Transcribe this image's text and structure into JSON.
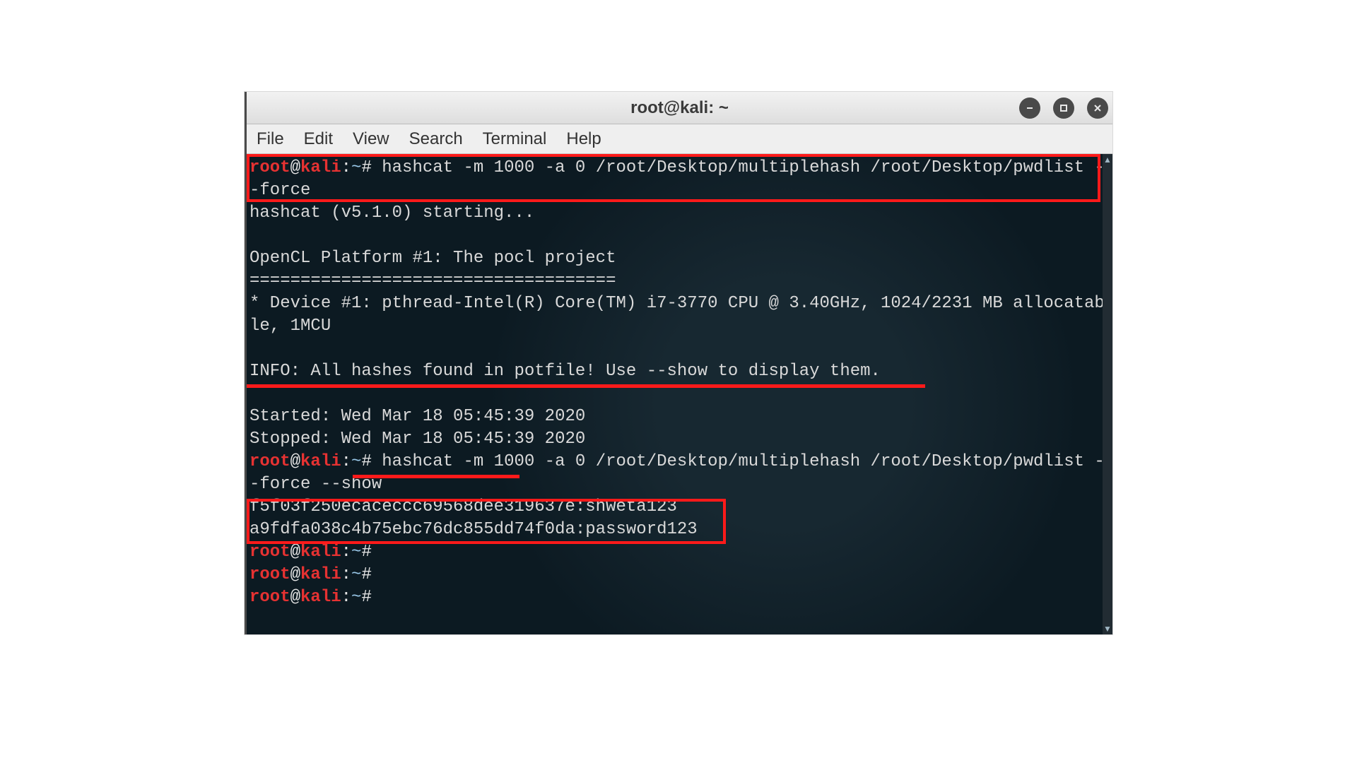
{
  "window": {
    "title": "root@kali: ~"
  },
  "menu": {
    "file": "File",
    "edit": "Edit",
    "view": "View",
    "search": "Search",
    "terminal": "Terminal",
    "help": "Help"
  },
  "prompt": {
    "user": "root",
    "host": "kali",
    "path": "~",
    "hash": "#"
  },
  "colors": {
    "prompt": "#e63232",
    "path": "#9ac9ea",
    "text": "#d9d9d9",
    "bg": "#0c1a22",
    "annotation": "#ff1a1a"
  },
  "lines": {
    "cmd1": " hashcat -m 1000 -a 0 /root/Desktop/multiplehash /root/Desktop/pwdlist --force",
    "out1": "hashcat (v5.1.0) starting...",
    "blank": "",
    "out2": "OpenCL Platform #1: The pocl project",
    "out3": "====================================",
    "out4": "* Device #1: pthread-Intel(R) Core(TM) i7-3770 CPU @ 3.40GHz, 1024/2231 MB allocatable, 1MCU",
    "info": "INFO: All hashes found in potfile! Use --show to display them.",
    "started": "Started: Wed Mar 18 05:45:39 2020",
    "stopped": "Stopped: Wed Mar 18 05:45:39 2020",
    "cmd2": " hashcat -m 1000 -a 0 /root/Desktop/multiplehash /root/Desktop/pwdlist --force --show",
    "hash1": "f5f03f250ecaceccc69568dee319637e:shweta123",
    "hash2": "a9fdfa038c4b75ebc76dc855dd74f0da:password123"
  }
}
